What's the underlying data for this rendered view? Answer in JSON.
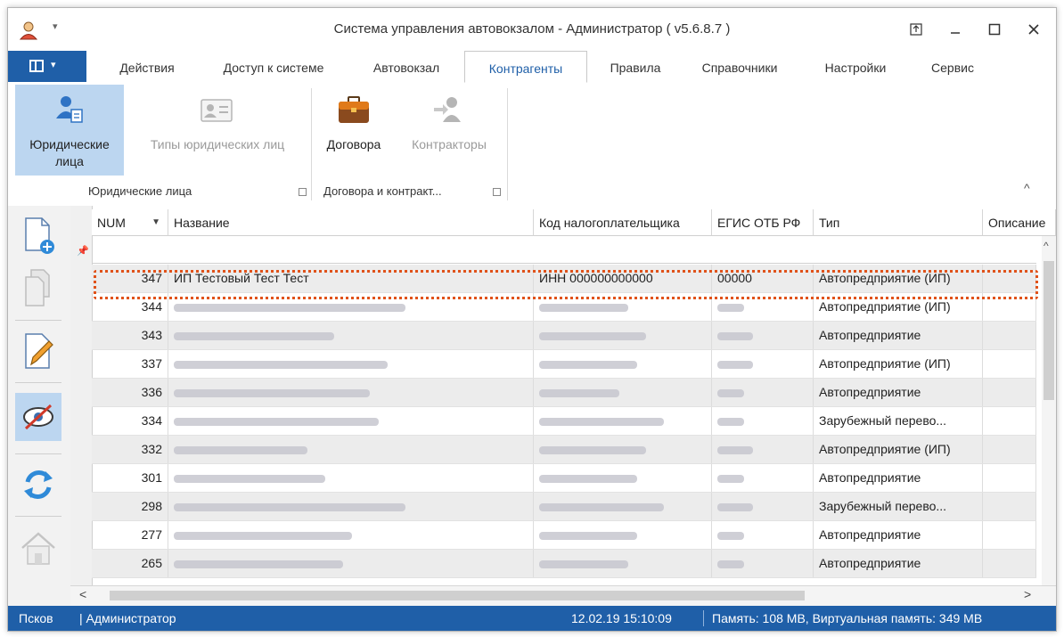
{
  "window": {
    "title": "Система управления автовокзалом - Администратор ( v5.6.8.7 )"
  },
  "ribbon_tabs": [
    "Действия",
    "Доступ к системе",
    "Автовокзал",
    "Контрагенты",
    "Правила",
    "Справочники",
    "Настройки",
    "Сервис"
  ],
  "active_tab": "Контрагенты",
  "ribbon": {
    "legal_entities_btn": "Юридические лица",
    "legal_types_btn": "Типы юридических лиц",
    "contracts_btn": "Договора",
    "contractors_btn": "Контракторы",
    "group1_label": "Юридические лица",
    "group2_label": "Договора и контракт..."
  },
  "grid": {
    "columns": [
      "NUM",
      "Название",
      "Код налогоплательщика",
      "ЕГИС ОТБ РФ",
      "Тип",
      "Описание"
    ],
    "rows": [
      {
        "num": "347",
        "name": "ИП Тестовый Тест Тест",
        "inn": "ИНН 000000000000",
        "egis": "00000",
        "type": "Автопредприятие (ИП)"
      },
      {
        "num": "344",
        "name": "",
        "inn": "",
        "egis": "",
        "type": "Автопредприятие (ИП)"
      },
      {
        "num": "343",
        "name": "",
        "inn": "",
        "egis": "",
        "type": "Автопредприятие"
      },
      {
        "num": "337",
        "name": "",
        "inn": "",
        "egis": "",
        "type": "Автопредприятие (ИП)"
      },
      {
        "num": "336",
        "name": "",
        "inn": "",
        "egis": "",
        "type": "Автопредприятие"
      },
      {
        "num": "334",
        "name": "",
        "inn": "",
        "egis": "",
        "type": "Зарубежный перево..."
      },
      {
        "num": "332",
        "name": "",
        "inn": "",
        "egis": "",
        "type": "Автопредприятие (ИП)"
      },
      {
        "num": "301",
        "name": "",
        "inn": "",
        "egis": "",
        "type": "Автопредприятие"
      },
      {
        "num": "298",
        "name": "",
        "inn": "",
        "egis": "",
        "type": "Зарубежный перево..."
      },
      {
        "num": "277",
        "name": "",
        "inn": "",
        "egis": "",
        "type": "Автопредприятие"
      },
      {
        "num": "265",
        "name": "",
        "inn": "",
        "egis": "",
        "type": "Автопредприятие"
      }
    ]
  },
  "status": {
    "city": "Псков",
    "user": "| Администратор",
    "datetime": "12.02.19 15:10:09",
    "memory": "Память: 108 MB, Виртуальная память: 349 MB"
  },
  "colors": {
    "accent": "#1f5fa8",
    "selected": "#bcd6f0",
    "highlight_border": "#e0521a"
  }
}
